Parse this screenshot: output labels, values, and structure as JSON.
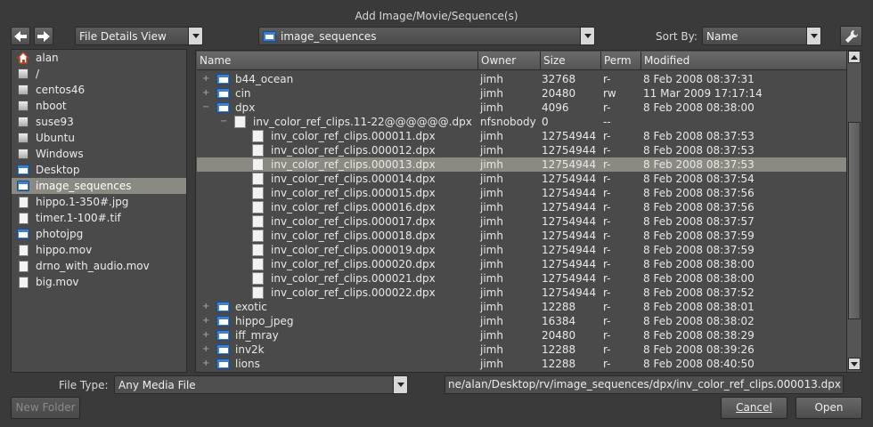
{
  "window": {
    "title": "Add Image/Movie/Sequence(s)"
  },
  "toolbar": {
    "view_mode": "File Details View",
    "current_dir": "image_sequences",
    "sort_label": "Sort By:",
    "sort_value": "Name"
  },
  "sidebar": {
    "items": [
      {
        "label": "alan",
        "icon": "home-icon"
      },
      {
        "label": "/",
        "icon": "drive-icon"
      },
      {
        "label": "centos46",
        "icon": "drive-icon"
      },
      {
        "label": "nboot",
        "icon": "drive-icon"
      },
      {
        "label": "suse93",
        "icon": "drive-icon"
      },
      {
        "label": "Ubuntu",
        "icon": "drive-icon"
      },
      {
        "label": "Windows",
        "icon": "drive-icon"
      },
      {
        "label": "Desktop",
        "icon": "folder-icon"
      },
      {
        "label": "image_sequences",
        "icon": "folder-icon",
        "selected": true
      },
      {
        "label": "hippo.1-350#.jpg",
        "icon": "file-icon"
      },
      {
        "label": "timer.1-100#.tif",
        "icon": "file-icon"
      },
      {
        "label": "photojpg",
        "icon": "folder-icon"
      },
      {
        "label": "hippo.mov",
        "icon": "file-icon"
      },
      {
        "label": "drno_with_audio.mov",
        "icon": "file-icon"
      },
      {
        "label": "big.mov",
        "icon": "file-icon"
      }
    ]
  },
  "table": {
    "columns": [
      "Name",
      "Owner",
      "Size",
      "Perm",
      "Modified"
    ],
    "rows": [
      {
        "depth": 0,
        "expander": "+",
        "icon": "folder-icon",
        "name": "b44_ocean",
        "owner": "jimh",
        "size": "32768",
        "perm": "r-",
        "modified": "8 Feb 2008 08:37:31"
      },
      {
        "depth": 0,
        "expander": "+",
        "icon": "folder-icon",
        "name": "cin",
        "owner": "jimh",
        "size": "20480",
        "perm": "rw",
        "modified": "11 Mar 2009 17:17:14"
      },
      {
        "depth": 0,
        "expander": "−",
        "icon": "folder-icon",
        "name": "dpx",
        "owner": "jimh",
        "size": "4096",
        "perm": "r-",
        "modified": "8 Feb 2008 08:38:00"
      },
      {
        "depth": 1,
        "expander": "−",
        "icon": "file-icon",
        "name": "inv_color_ref_clips.11-22@@@@@@.dpx",
        "owner": "nfsnobody",
        "size": "0",
        "perm": "--",
        "modified": ""
      },
      {
        "depth": 2,
        "expander": "",
        "icon": "file-icon",
        "name": "inv_color_ref_clips.000011.dpx",
        "owner": "jimh",
        "size": "12754944",
        "perm": "r-",
        "modified": "8 Feb 2008 08:37:53"
      },
      {
        "depth": 2,
        "expander": "",
        "icon": "file-icon",
        "name": "inv_color_ref_clips.000012.dpx",
        "owner": "jimh",
        "size": "12754944",
        "perm": "r-",
        "modified": "8 Feb 2008 08:37:53"
      },
      {
        "depth": 2,
        "expander": "",
        "icon": "file-icon",
        "name": "inv_color_ref_clips.000013.dpx",
        "owner": "jimh",
        "size": "12754944",
        "perm": "r-",
        "modified": "8 Feb 2008 08:37:53",
        "selected": true
      },
      {
        "depth": 2,
        "expander": "",
        "icon": "file-icon",
        "name": "inv_color_ref_clips.000014.dpx",
        "owner": "jimh",
        "size": "12754944",
        "perm": "r-",
        "modified": "8 Feb 2008 08:37:54"
      },
      {
        "depth": 2,
        "expander": "",
        "icon": "file-icon",
        "name": "inv_color_ref_clips.000015.dpx",
        "owner": "jimh",
        "size": "12754944",
        "perm": "r-",
        "modified": "8 Feb 2008 08:37:56"
      },
      {
        "depth": 2,
        "expander": "",
        "icon": "file-icon",
        "name": "inv_color_ref_clips.000016.dpx",
        "owner": "jimh",
        "size": "12754944",
        "perm": "r-",
        "modified": "8 Feb 2008 08:37:56"
      },
      {
        "depth": 2,
        "expander": "",
        "icon": "file-icon",
        "name": "inv_color_ref_clips.000017.dpx",
        "owner": "jimh",
        "size": "12754944",
        "perm": "r-",
        "modified": "8 Feb 2008 08:37:57"
      },
      {
        "depth": 2,
        "expander": "",
        "icon": "file-icon",
        "name": "inv_color_ref_clips.000018.dpx",
        "owner": "jimh",
        "size": "12754944",
        "perm": "r-",
        "modified": "8 Feb 2008 08:37:59"
      },
      {
        "depth": 2,
        "expander": "",
        "icon": "file-icon",
        "name": "inv_color_ref_clips.000019.dpx",
        "owner": "jimh",
        "size": "12754944",
        "perm": "r-",
        "modified": "8 Feb 2008 08:37:59"
      },
      {
        "depth": 2,
        "expander": "",
        "icon": "file-icon",
        "name": "inv_color_ref_clips.000020.dpx",
        "owner": "jimh",
        "size": "12754944",
        "perm": "r-",
        "modified": "8 Feb 2008 08:38:00"
      },
      {
        "depth": 2,
        "expander": "",
        "icon": "file-icon",
        "name": "inv_color_ref_clips.000021.dpx",
        "owner": "jimh",
        "size": "12754944",
        "perm": "r-",
        "modified": "8 Feb 2008 08:38:00"
      },
      {
        "depth": 2,
        "expander": "",
        "icon": "file-icon",
        "name": "inv_color_ref_clips.000022.dpx",
        "owner": "jimh",
        "size": "12754944",
        "perm": "r-",
        "modified": "8 Feb 2008 08:37:52"
      },
      {
        "depth": 0,
        "expander": "+",
        "icon": "folder-icon",
        "name": "exotic",
        "owner": "jimh",
        "size": "12288",
        "perm": "r-",
        "modified": "8 Feb 2008 08:38:01"
      },
      {
        "depth": 0,
        "expander": "+",
        "icon": "folder-icon",
        "name": "hippo_jpeg",
        "owner": "jimh",
        "size": "16384",
        "perm": "r-",
        "modified": "8 Feb 2008 08:38:02"
      },
      {
        "depth": 0,
        "expander": "+",
        "icon": "folder-icon",
        "name": "iff_mray",
        "owner": "jimh",
        "size": "20480",
        "perm": "r-",
        "modified": "8 Feb 2008 08:38:29"
      },
      {
        "depth": 0,
        "expander": "+",
        "icon": "folder-icon",
        "name": "inv2k",
        "owner": "jimh",
        "size": "12288",
        "perm": "r-",
        "modified": "8 Feb 2008 08:39:26"
      },
      {
        "depth": 0,
        "expander": "+",
        "icon": "folder-icon",
        "name": "lions",
        "owner": "jimh",
        "size": "12288",
        "perm": "r-",
        "modified": "8 Feb 2008 08:40:50"
      }
    ]
  },
  "footer": {
    "file_type_label": "File Type:",
    "file_type_value": "Any Media File",
    "path_value": "ne/alan/Desktop/rv/image_sequences/dpx/inv_color_ref_clips.000013.dpx",
    "new_folder_label": "New Folder",
    "cancel_label": "Cancel",
    "open_label": "Open"
  },
  "colors": {
    "background": "#3a3a3a",
    "selection": "#8a8a82",
    "folder": "#3f7fd0"
  }
}
